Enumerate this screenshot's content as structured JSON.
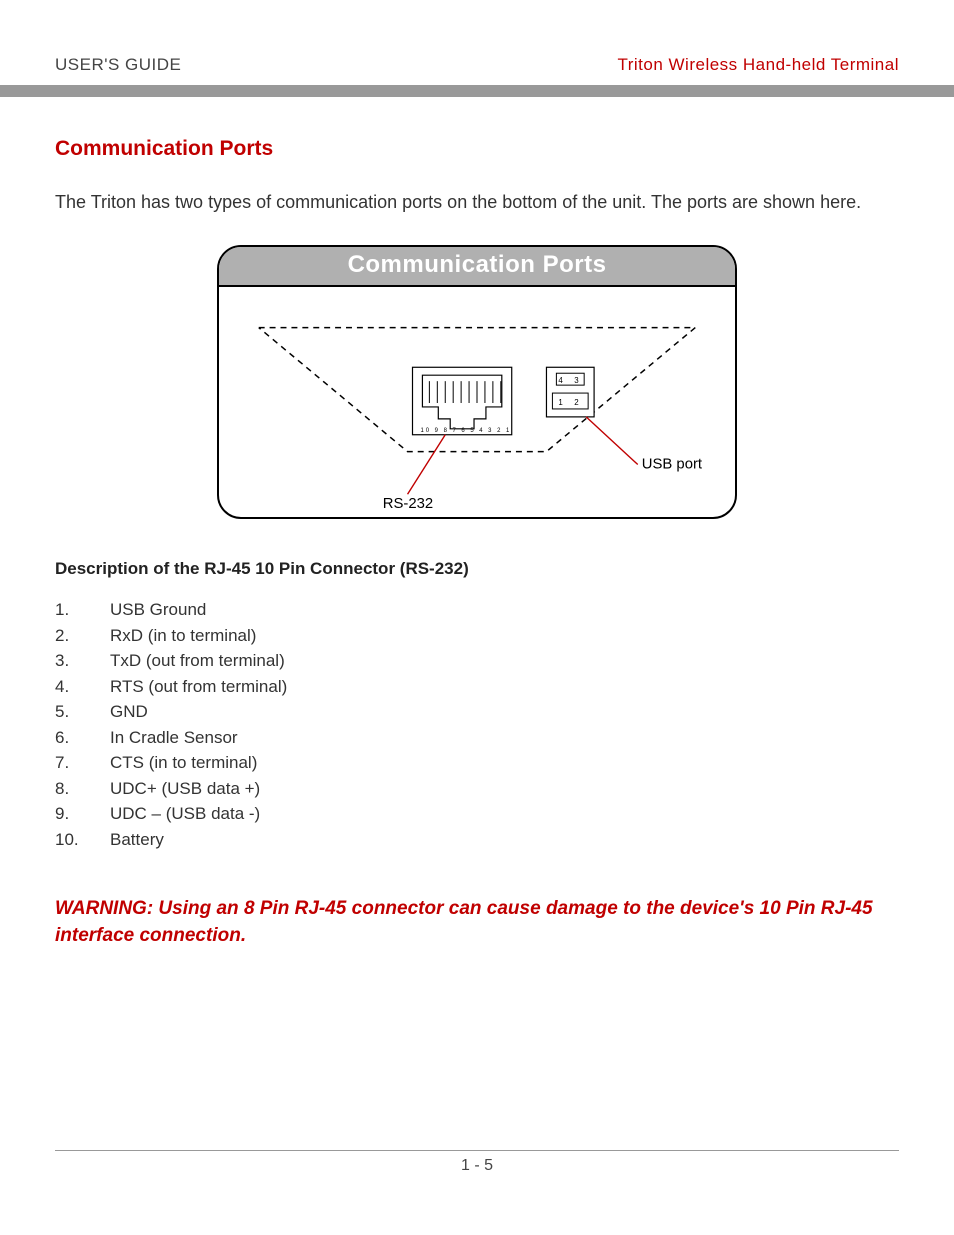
{
  "header": {
    "left": "USER'S GUIDE",
    "right": "Triton Wireless Hand-held Terminal"
  },
  "section_title": "Communication Ports",
  "intro": "The Triton has two types of communication ports on the bottom of the unit. The ports are shown here.",
  "diagram": {
    "title": "Communication Ports",
    "label_rs232": "RS-232",
    "label_usb": "USB port",
    "rj_pin_digits": "10 9 8 7 6 5 4 3 2 1",
    "usb_pins": {
      "p1": "1",
      "p2": "2",
      "p3": "3",
      "p4": "4"
    }
  },
  "sub_heading": "Description of the RJ-45 10 Pin Connector (RS-232)",
  "pins": [
    "USB Ground",
    "RxD (in to terminal)",
    "TxD (out from terminal)",
    "RTS (out from terminal)",
    "GND",
    "In Cradle Sensor",
    "CTS (in to terminal)",
    "UDC+ (USB data +)",
    "UDC – (USB data -)",
    "Battery"
  ],
  "warning": "WARNING: Using an 8 Pin RJ-45 connector can cause damage to the device's 10 Pin RJ-45 interface connection.",
  "footer": "1 - 5"
}
